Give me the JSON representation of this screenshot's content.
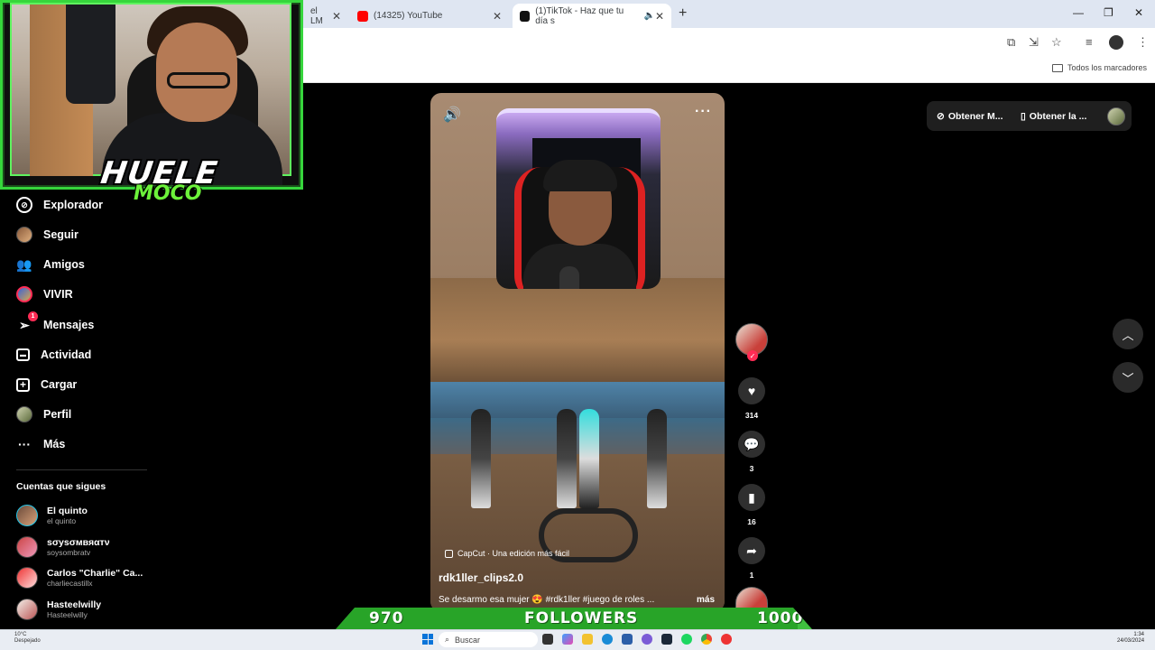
{
  "browser": {
    "tabs": [
      {
        "label": "el LM",
        "favicon_color": "#555555"
      },
      {
        "label": "(14325) YouTube",
        "favicon_color": "#ff0000"
      },
      {
        "label": "(1)TikTok - Haz que tu día s",
        "favicon_color": "#111111"
      }
    ],
    "new_tab_icon": "plus-icon",
    "bookmarks_label": "Todos los marcadores"
  },
  "overlay": {
    "logo_top": "HUELE",
    "logo_bottom": "MOCO"
  },
  "sidebar": {
    "items": [
      {
        "label": "Explorador",
        "icon": "compass-icon"
      },
      {
        "label": "Seguir",
        "icon": "avatar-icon"
      },
      {
        "label": "Amigos",
        "icon": "people-icon"
      },
      {
        "label": "VIVIR",
        "icon": "live-icon"
      },
      {
        "label": "Mensajes",
        "icon": "send-icon",
        "badge": "1"
      },
      {
        "label": "Actividad",
        "icon": "message-box-icon"
      },
      {
        "label": "Cargar",
        "icon": "plus-square-icon"
      },
      {
        "label": "Perfil",
        "icon": "profile-avatar-icon"
      },
      {
        "label": "Más",
        "icon": "ellipsis-icon"
      }
    ],
    "following_title": "Cuentas que sigues",
    "following": [
      {
        "name": "El quinto",
        "handle": "el quinto"
      },
      {
        "name": "sσуsσмвяαтν",
        "handle": "soysombratv"
      },
      {
        "name": "Carlos \"Charlie\" Ca...",
        "handle": "charliecastillx"
      },
      {
        "name": "Hasteelwilly",
        "handle": "Hasteelwilly"
      }
    ]
  },
  "video": {
    "capcut_label": "CapCut · Una edición más fácil",
    "username": "rdk1ller_clips2.0",
    "description": "Se desarmo esa mujer 😍 #rdk1ller #juego de roles ...",
    "more_label": "más",
    "likes": "314",
    "comments": "3",
    "saves": "16",
    "shares": "1"
  },
  "top_right": {
    "get_app_1": "Obtener M...",
    "get_app_2": "Obtener la ..."
  },
  "goal": {
    "current": "970",
    "label": "FOLLOWERS",
    "target": "1000",
    "progress": 0.97,
    "color": "#3fbf3f"
  },
  "taskbar": {
    "weather_temp": "10°C",
    "weather_desc": "Despejado",
    "search_placeholder": "Buscar",
    "time": "1:34",
    "date": "24/03/2024"
  },
  "colors": {
    "tiktok_red": "#fe2c55",
    "stream_green": "#36d63c"
  }
}
